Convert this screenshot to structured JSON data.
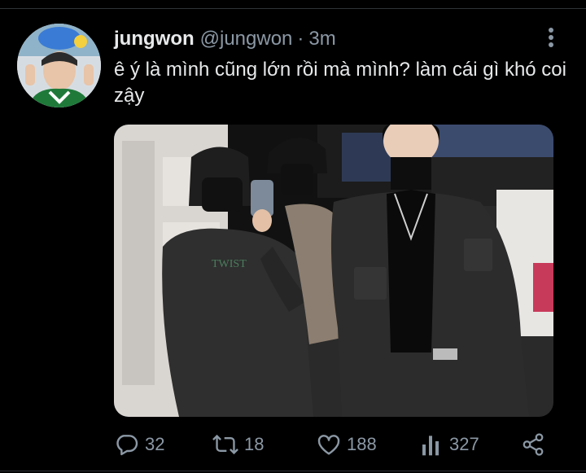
{
  "tweet": {
    "display_name": "jungwon",
    "handle": "@jungwon",
    "separator": "·",
    "time": "3m",
    "text": "ê ý là mình cũng lớn rồi mà mình? làm cái gì khó coi zậy"
  },
  "actions": {
    "replies": "32",
    "retweets": "18",
    "likes": "188",
    "views": "327"
  },
  "icons": [
    "more-vertical-icon",
    "reply-icon",
    "retweet-icon",
    "like-icon",
    "views-icon",
    "share-icon"
  ],
  "colors": {
    "background": "#000000",
    "text": "#e7e9ea",
    "secondary_text": "#8b98a5",
    "divider": "#2f3336"
  }
}
